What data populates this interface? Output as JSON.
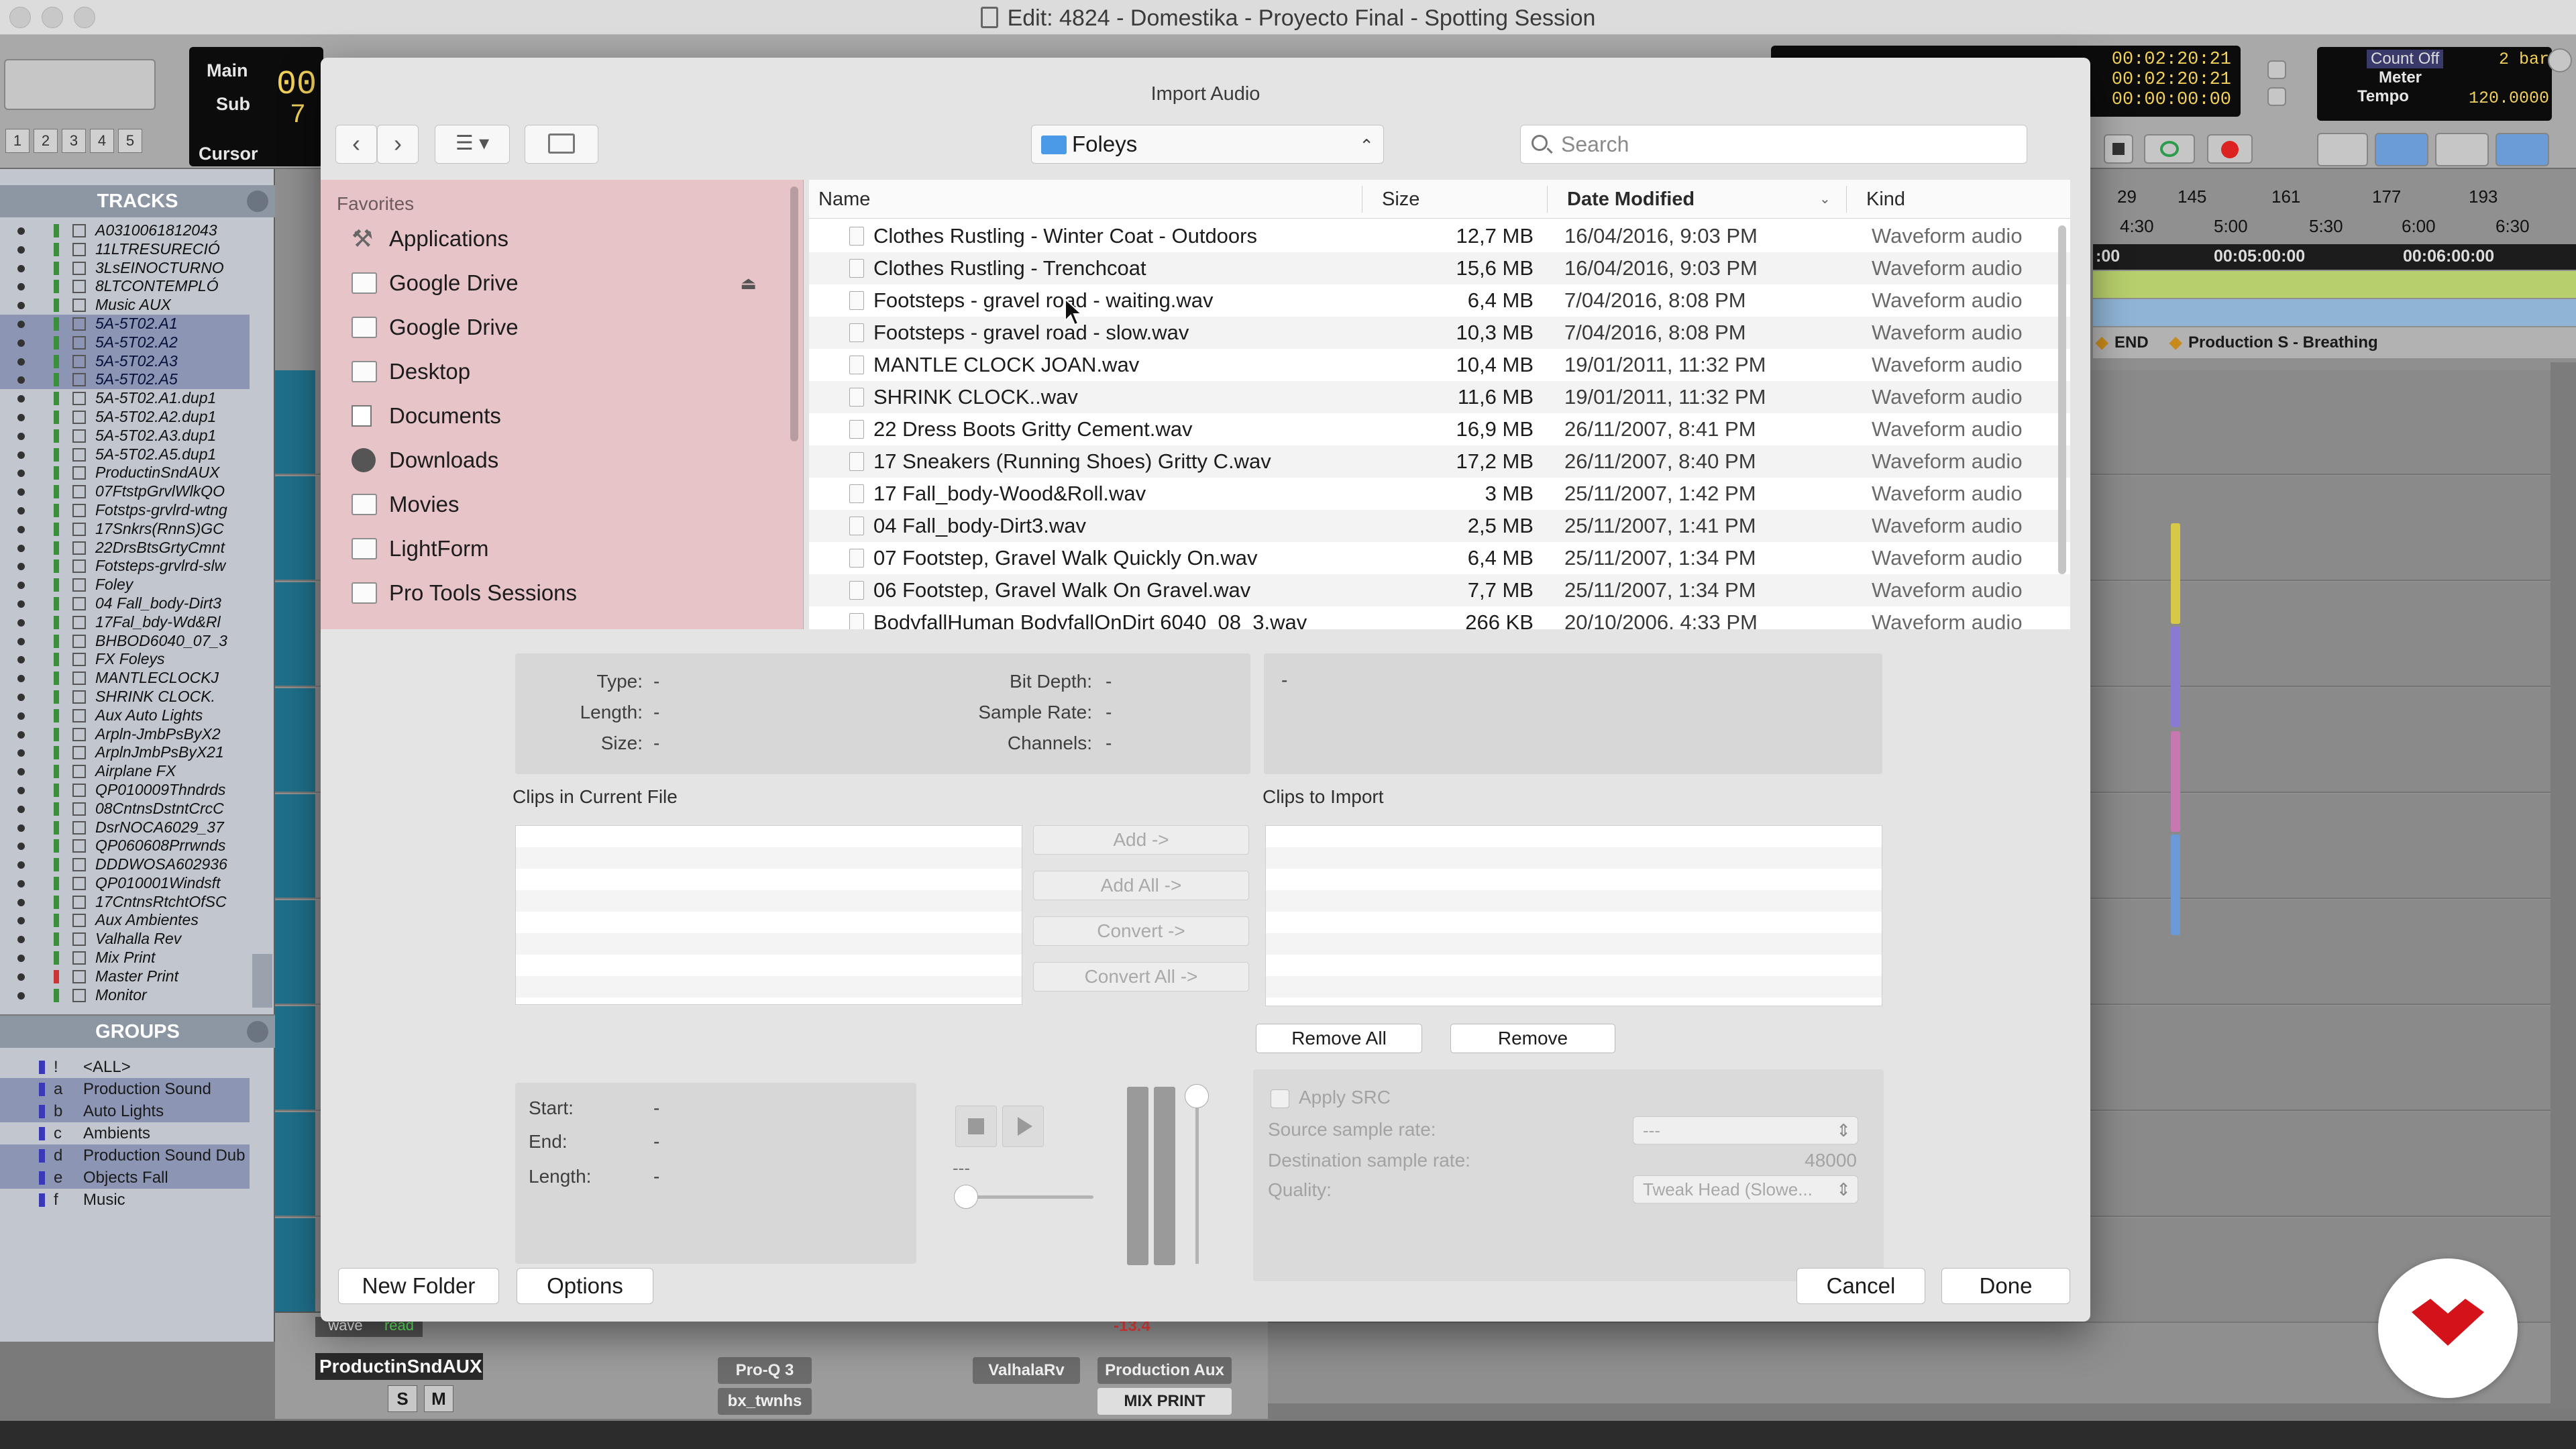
{
  "window": {
    "title": "Edit: 4824 - Domestika - Proyecto Final - Spotting Session"
  },
  "counters": {
    "main_label": "Main",
    "sub_label": "Sub",
    "cursor_label": "Cursor",
    "main_value": "00",
    "sub_value": "7",
    "sel_start": "00:02:20:21",
    "sel_end": "00:02:20:21",
    "sel_length": "00:00:00:00",
    "count_off": "Count Off",
    "meter": "Meter",
    "tempo": "Tempo",
    "bars": "2 bar",
    "tempo_value": "120.0000"
  },
  "nudge_buttons": [
    "1",
    "2",
    "3",
    "4",
    "5"
  ],
  "tracks_panel": {
    "title": "TRACKS",
    "items": [
      {
        "name": "A0310061812043",
        "sel": false
      },
      {
        "name": "11LTRESURECIÓ",
        "sel": false
      },
      {
        "name": "3LsEINOCTURNO",
        "sel": false
      },
      {
        "name": "8LTCONTEMPLÓ",
        "sel": false
      },
      {
        "name": "Music AUX",
        "sel": false
      },
      {
        "name": "5A-5T02.A1",
        "sel": true
      },
      {
        "name": "5A-5T02.A2",
        "sel": true
      },
      {
        "name": "5A-5T02.A3",
        "sel": true
      },
      {
        "name": "5A-5T02.A5",
        "sel": true
      },
      {
        "name": "5A-5T02.A1.dup1",
        "sel": false
      },
      {
        "name": "5A-5T02.A2.dup1",
        "sel": false
      },
      {
        "name": "5A-5T02.A3.dup1",
        "sel": false
      },
      {
        "name": "5A-5T02.A5.dup1",
        "sel": false
      },
      {
        "name": "ProductinSndAUX",
        "sel": false
      },
      {
        "name": "07FtstpGrvlWlkQO",
        "sel": false
      },
      {
        "name": "Fotstps-grvlrd-wtng",
        "sel": false
      },
      {
        "name": "17Snkrs(RnnS)GC",
        "sel": false
      },
      {
        "name": "22DrsBtsGrtyCmnt",
        "sel": false
      },
      {
        "name": "Fotsteps-grvlrd-slw",
        "sel": false
      },
      {
        "name": "Foley",
        "sel": false
      },
      {
        "name": "04 Fall_body-Dirt3",
        "sel": false
      },
      {
        "name": "17Fal_bdy-Wd&Rl",
        "sel": false
      },
      {
        "name": "BHBOD6040_07_3",
        "sel": false
      },
      {
        "name": "FX Foleys",
        "sel": false
      },
      {
        "name": "MANTLECLOCKJ",
        "sel": false
      },
      {
        "name": "SHRINK CLOCK.",
        "sel": false
      },
      {
        "name": "Aux Auto Lights",
        "sel": false
      },
      {
        "name": "Arpln-JmbPsByX2",
        "sel": false
      },
      {
        "name": "ArplnJmbPsByX21",
        "sel": false
      },
      {
        "name": "Airplane FX",
        "sel": false
      },
      {
        "name": "QP010009Thndrds",
        "sel": false
      },
      {
        "name": "08CntnsDstntCrcC",
        "sel": false
      },
      {
        "name": "DsrNOCA6029_37",
        "sel": false
      },
      {
        "name": "QP060608Prrwnds",
        "sel": false
      },
      {
        "name": "DDDWOSA602936",
        "sel": false
      },
      {
        "name": "QP010001Windsft",
        "sel": false
      },
      {
        "name": "17CntnsRtchtOfSC",
        "sel": false
      },
      {
        "name": "Aux Ambientes",
        "sel": false
      },
      {
        "name": "Valhalla Rev",
        "sel": false
      },
      {
        "name": "Mix Print",
        "sel": false
      },
      {
        "name": "Master Print",
        "sel": false
      },
      {
        "name": "Monitor",
        "sel": false
      }
    ]
  },
  "groups_panel": {
    "title": "GROUPS",
    "items": [
      {
        "id": "!",
        "name": "<ALL>",
        "sel": false
      },
      {
        "id": "a",
        "name": "Production Sound",
        "sel": true
      },
      {
        "id": "b",
        "name": "Auto Lights",
        "sel": true
      },
      {
        "id": "c",
        "name": "Ambients",
        "sel": false
      },
      {
        "id": "d",
        "name": "Production Sound Dub",
        "sel": true
      },
      {
        "id": "e",
        "name": "Objects Fall",
        "sel": true
      },
      {
        "id": "f",
        "name": "Music",
        "sel": false
      }
    ]
  },
  "ruler": {
    "bars": [
      "29",
      "145",
      "161",
      "177",
      "193"
    ],
    "times": [
      "4:30",
      "5:00",
      "5:30",
      "6:00",
      "6:30"
    ],
    "timecodes": [
      ":00",
      "00:05:00:00",
      "00:06:00:00"
    ],
    "markers": [
      "END",
      "Production S - Breathing"
    ]
  },
  "mix_strip": {
    "track_name": "ProductinSndAUX",
    "plugins": [
      "Pro-Q 3",
      "bx_twnhs",
      "ValhalaRv",
      "Production Aux",
      "MIX PRINT"
    ],
    "level": "-13.4",
    "mode": "wave",
    "read": "read"
  },
  "dialog": {
    "title": "Import Audio",
    "folder": "Foleys",
    "search_placeholder": "Search",
    "sidebar_header": "Favorites",
    "favorites": [
      "Applications",
      "Google Drive",
      "Google Drive",
      "Desktop",
      "Documents",
      "Downloads",
      "Movies",
      "LightForm",
      "Pro Tools Sessions"
    ],
    "columns": {
      "name": "Name",
      "size": "Size",
      "date": "Date Modified",
      "kind": "Kind"
    },
    "files": [
      {
        "name": "Clothes Rustling - Winter Coat - Outdoors",
        "size": "12,7 MB",
        "date": "16/04/2016, 9:03 PM",
        "kind": "Waveform audio"
      },
      {
        "name": "Clothes Rustling - Trenchcoat",
        "size": "15,6 MB",
        "date": "16/04/2016, 9:03 PM",
        "kind": "Waveform audio"
      },
      {
        "name": "Footsteps - gravel road - waiting.wav",
        "size": "6,4 MB",
        "date": "7/04/2016, 8:08 PM",
        "kind": "Waveform audio"
      },
      {
        "name": "Footsteps - gravel road - slow.wav",
        "size": "10,3 MB",
        "date": "7/04/2016, 8:08 PM",
        "kind": "Waveform audio"
      },
      {
        "name": "MANTLE CLOCK JOAN.wav",
        "size": "10,4 MB",
        "date": "19/01/2011, 11:32 PM",
        "kind": "Waveform audio"
      },
      {
        "name": "SHRINK CLOCK..wav",
        "size": "11,6 MB",
        "date": "19/01/2011, 11:32 PM",
        "kind": "Waveform audio"
      },
      {
        "name": "22 Dress Boots Gritty Cement.wav",
        "size": "16,9 MB",
        "date": "26/11/2007, 8:41 PM",
        "kind": "Waveform audio"
      },
      {
        "name": "17 Sneakers (Running Shoes) Gritty C.wav",
        "size": "17,2 MB",
        "date": "26/11/2007, 8:40 PM",
        "kind": "Waveform audio"
      },
      {
        "name": "17 Fall_body-Wood&Roll.wav",
        "size": "3 MB",
        "date": "25/11/2007, 1:42 PM",
        "kind": "Waveform audio"
      },
      {
        "name": "04 Fall_body-Dirt3.wav",
        "size": "2,5 MB",
        "date": "25/11/2007, 1:41 PM",
        "kind": "Waveform audio"
      },
      {
        "name": "07 Footstep, Gravel Walk Quickly On.wav",
        "size": "6,4 MB",
        "date": "25/11/2007, 1:34 PM",
        "kind": "Waveform audio"
      },
      {
        "name": "06 Footstep, Gravel Walk On Gravel.wav",
        "size": "7,7 MB",
        "date": "25/11/2007, 1:34 PM",
        "kind": "Waveform audio"
      },
      {
        "name": "BodyfallHuman BodyfallOnDirt 6040_08_3.wav",
        "size": "266 KB",
        "date": "20/10/2006, 4:33 PM",
        "kind": "Waveform audio"
      }
    ],
    "info": {
      "type_label": "Type:",
      "type_value": "-",
      "length_label": "Length:",
      "length_value": "-",
      "size_label": "Size:",
      "size_value": "-",
      "bitdepth_label": "Bit Depth:",
      "bitdepth_value": "-",
      "samplerate_label": "Sample Rate:",
      "samplerate_value": "-",
      "channels_label": "Channels:",
      "channels_value": "-",
      "comment_value": "-"
    },
    "clips_current_label": "Clips in Current File",
    "clips_import_label": "Clips to Import",
    "buttons": {
      "add": "Add ->",
      "add_all": "Add All ->",
      "convert": "Convert ->",
      "convert_all": "Convert All ->",
      "remove_all": "Remove All",
      "remove": "Remove",
      "new_folder": "New Folder",
      "options": "Options",
      "cancel": "Cancel",
      "done": "Done"
    },
    "preview": {
      "start_label": "Start:",
      "start_value": "-",
      "end_label": "End:",
      "end_value": "-",
      "length_label": "Length:",
      "length_value": "-",
      "position": "---"
    },
    "src": {
      "apply_label": "Apply SRC",
      "source_label": "Source sample rate:",
      "source_value": "---",
      "dest_label": "Destination sample rate:",
      "dest_value": "48000",
      "quality_label": "Quality:",
      "quality_value": "Tweak Head (Slowe..."
    }
  }
}
